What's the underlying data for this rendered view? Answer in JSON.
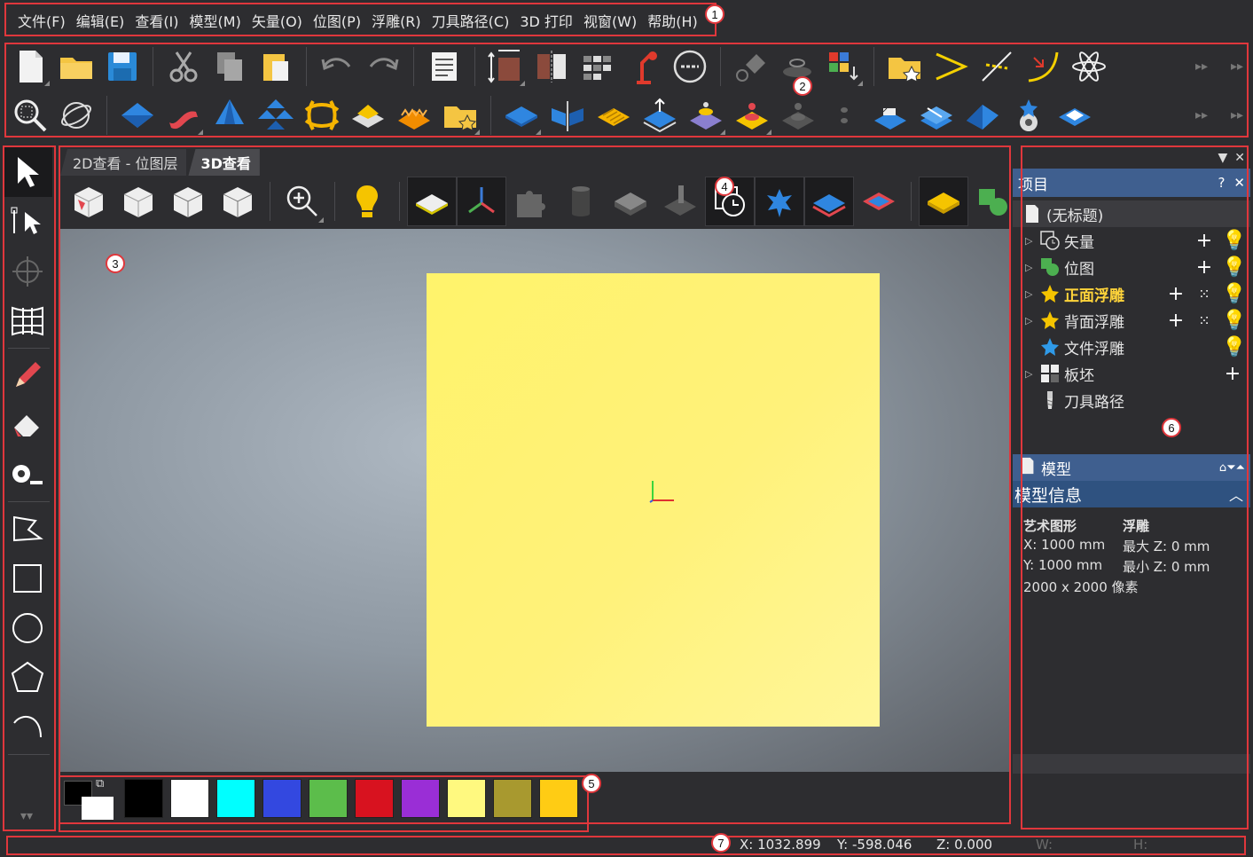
{
  "menu": {
    "items": [
      "文件(F)",
      "编辑(E)",
      "查看(I)",
      "模型(M)",
      "矢量(O)",
      "位图(P)",
      "浮雕(R)",
      "刀具路径(C)",
      "3D 打印",
      "视窗(W)",
      "帮助(H)"
    ]
  },
  "toolbar_row_1": [
    "new-file-icon",
    "open-folder-icon",
    "save-icon",
    "cut-icon",
    "copy-icon",
    "paste-icon",
    "undo-icon",
    "redo-icon",
    "notes-icon",
    "resize-icon",
    "mirror-icon",
    "grid-icon",
    "lamp-icon",
    "link-icon",
    "paint-icon",
    "layer-icon",
    "palette-icon",
    "favorite-icon",
    "vector-icon",
    "trim-icon",
    "curve-icon",
    "star-burst-icon"
  ],
  "toolbar_row_2": [
    "zoom-icon",
    "orbit-icon",
    "relief-diamond-icon",
    "ribbon-icon",
    "spin-icon",
    "multi-icon",
    "weave-icon",
    "block-icon",
    "texture-icon",
    "favorite-relief-icon",
    "flat-diamond-icon",
    "split-icon",
    "stripes-icon",
    "raise-icon",
    "sculpt-icon",
    "stamp-icon",
    "stamp-gray-icon",
    "dots-icon",
    "fold-icon",
    "slab-icon",
    "wedge-icon",
    "compass-icon",
    "plate-icon"
  ],
  "view": {
    "tabs": [
      {
        "label": "2D查看 - 位图层",
        "active": false
      },
      {
        "label": "3D查看",
        "active": true
      }
    ]
  },
  "palette": {
    "foreground": "#000000",
    "background": "#ffffff",
    "colors": [
      "#000000",
      "#ffffff",
      "#00ffff",
      "#3348e0",
      "#5cbd4b",
      "#d8121f",
      "#9a2ed6",
      "#fff97f",
      "#a8992f",
      "#ffcc14"
    ]
  },
  "project_panel": {
    "title": "项目",
    "help": "?",
    "close": "✕",
    "root": "(无标题)",
    "items": [
      {
        "label": "矢量",
        "bold": false
      },
      {
        "label": "位图",
        "bold": false
      },
      {
        "label": "正面浮雕",
        "bold": true
      },
      {
        "label": "背面浮雕",
        "bold": false
      },
      {
        "label": "文件浮雕",
        "bold": false
      },
      {
        "label": "板坯",
        "bold": false
      },
      {
        "label": "刀具路径",
        "bold": false
      }
    ]
  },
  "model_panel": {
    "title": "模型",
    "info_title": "模型信息",
    "art_label": "艺术图形",
    "relief_label": "浮雕",
    "x": "X: 1000 mm",
    "y": "Y: 1000 mm",
    "pixels": "2000 x 2000 像素",
    "max_z": "最大 Z: 0 mm",
    "min_z": "最小 Z: 0 mm"
  },
  "status": {
    "x": "X: 1032.899",
    "y": "Y: -598.046",
    "z": "Z: 0.000",
    "w": "W:",
    "h": "H:"
  },
  "annotations": [
    "1",
    "2",
    "3",
    "4",
    "5",
    "6",
    "7"
  ]
}
